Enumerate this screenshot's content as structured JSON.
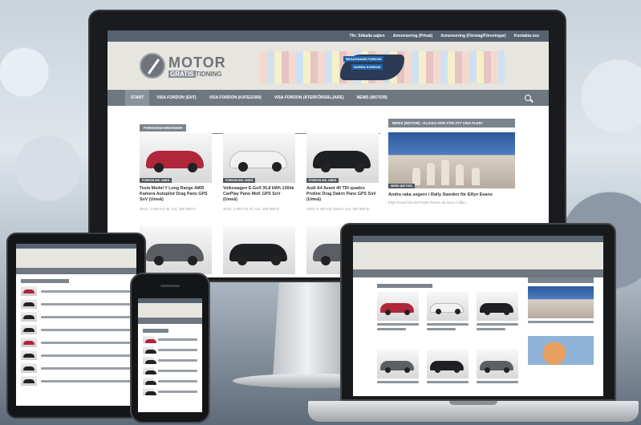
{
  "site": {
    "topbar_links": [
      "Tfn: Sökalla sajten",
      "Annonsering (Privat)",
      "Annonsering (Företag/Föreningar)",
      "Kontakta oss"
    ],
    "logo_main": "MOTOR",
    "logo_sub_a": "GRATIS",
    "logo_sub_b": "TIDNING",
    "banner_label_1": "BEGAGNADE FORDON",
    "banner_label_2": "NORRA SVERIGE",
    "nav": [
      "START",
      "VISA FORDON (ENT)",
      "VISA FORDON (KATEGORI)",
      "VISA FORDON (ÅTERFÖRSÄLJARE)",
      "NEWS (MOTOR)"
    ],
    "section_title": "FORDONSANNONSER",
    "cards": [
      {
        "tag": "FORDON INS. UMEÅ",
        "title": "Tesla Model Y Long Range AWD Kamera Autopilot Drag Pano GPS SoV (Umeå)",
        "meta": "2016, 4 400 mil, El, Aut, 165 900 kr",
        "color": "#b0263a"
      },
      {
        "tag": "FORDON INS. UMEÅ",
        "title": "Volkswagen E-Golf 35.8 kWh 136hk CarPlay Pano MoK GPS SoV (Umeå)",
        "meta": "2018, 4 400 mil, El, Aut, 169 900 kr",
        "color": "#f1f1f1"
      },
      {
        "tag": "FORDON INS. UMEÅ",
        "title": "Audi A4 Avant 40 TDI quattro Proline Drag Dakrn Pano GPS SoV (Umeå)",
        "meta": "2020, 8 400 mil, Diesel, Aut, 264 900 kr",
        "color": "#1d1f22"
      }
    ],
    "sidebar_heading": "NEWS (MOTOR) - KLICKA HÄR FÖR ATT VISA FLER!",
    "sidebar_tag": "NEWS (MOTOR)",
    "sidebar_title": "Andra raka segern i Rally Sweden för Elfyn Evans",
    "sidebar_text": "Elfyn Evans blev den förste föraren att vinna 4 rallyt..."
  },
  "colors": {
    "topbar": "#566270",
    "nav": "#6f7881",
    "section": "#7b848d",
    "header_bg": "#e6e5df"
  }
}
